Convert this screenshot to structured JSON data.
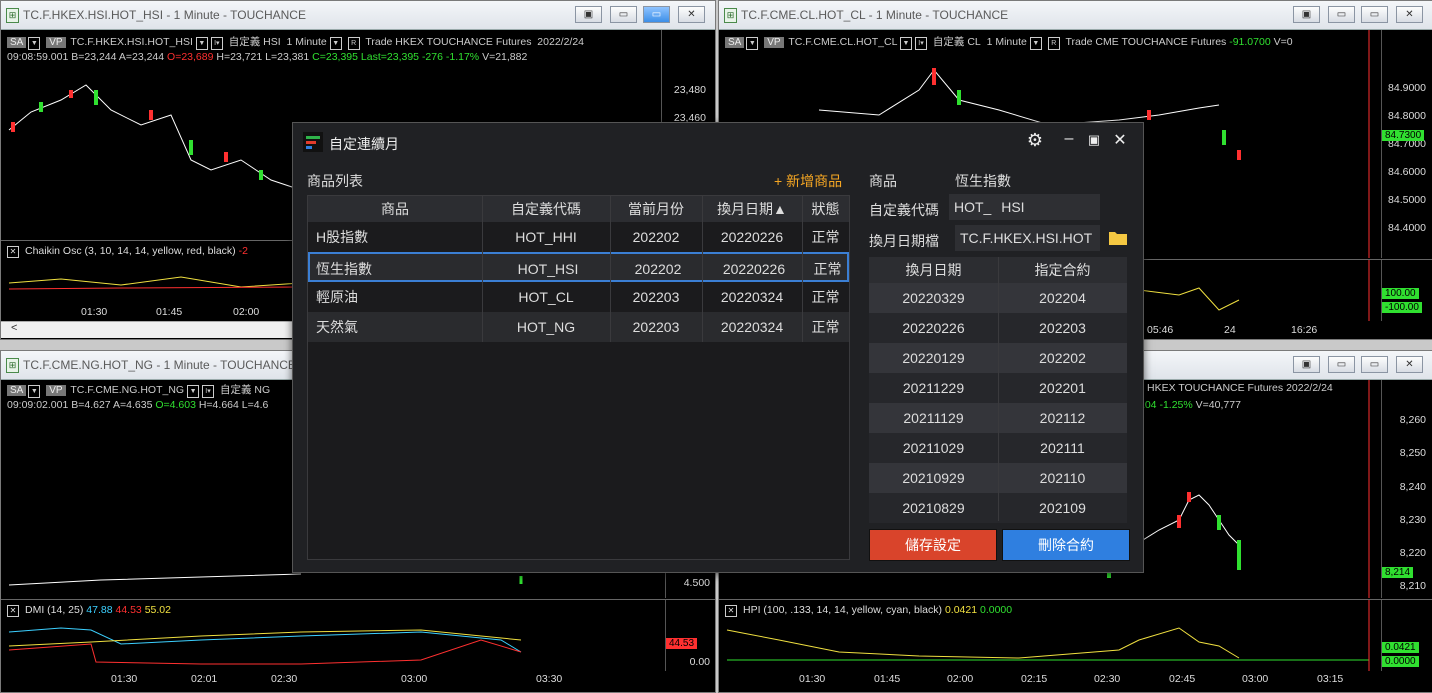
{
  "windows": {
    "hsi": {
      "title": "TC.F.HKEX.HSI.HOT_HSI - 1 Minute - TOUCHANCE",
      "sa": "SA",
      "vp": "VP",
      "symbol": "TC.F.HKEX.HSI.HOT_HSI",
      "custom": "自定義 HSI",
      "interval": "1 Minute",
      "r": "R",
      "trade": "Trade  HKEX  TOUCHANCE  Futures",
      "date": "2022/2/24",
      "time": "09:08:59.001",
      "bid": "B=23,244",
      "ask": "A=23,244",
      "open": "O=23,689",
      "high": "H=23,721",
      "low": "L=23,381",
      "close": "C=23,395",
      "last": "Last=23,395",
      "chg": "-276",
      "pct": "-1.17%",
      "vol": "V=21,882",
      "yticks": [
        "23,480",
        "23,460"
      ],
      "indicator": "Chaikin Osc   (3,  10,  14,  14,  yellow,  red,  black)",
      "indicator_value": "-2",
      "xticks": [
        "01:30",
        "01:45",
        "02:00"
      ],
      "scroll_left": "<"
    },
    "cl": {
      "title": "TC.F.CME.CL.HOT_CL - 1 Minute - TOUCHANCE",
      "sa": "SA",
      "vp": "VP",
      "symbol": "TC.F.CME.CL.HOT_CL",
      "custom": "自定義 CL",
      "interval": "1 Minute",
      "r": "R",
      "trade": "Trade  CME  TOUCHANCE  Futures",
      "chg": "-91.0700",
      "vol": "V=0",
      "yticks": [
        "84.9000",
        "84.8000",
        "84.7000",
        "84.6000",
        "84.5000",
        "84.4000"
      ],
      "last_tag": "84.7300",
      "sub_tags": [
        "100.00",
        "-100.00"
      ],
      "xticks": [
        "05:46",
        "24",
        "16:26"
      ]
    },
    "ng": {
      "title": "TC.F.CME.NG.HOT_NG - 1 Minute - TOUCHANCE",
      "sa": "SA",
      "vp": "VP",
      "symbol": "TC.F.CME.NG.HOT_NG",
      "custom": "自定義 NG",
      "time": "09:09:02.001",
      "bid": "B=4.627",
      "ask": "A=4.635",
      "open": "O=4.603",
      "high": "H=4.664",
      "low": "L=4.6",
      "ytick": "4.500",
      "indicator": "DMI     (14,  25)",
      "v1": "47.88",
      "v2": "44.53",
      "v3": "55.02",
      "tag1": "44.53",
      "tag2": "0.00",
      "xticks": [
        "01:30",
        "02:01",
        "02:30",
        "03:00",
        "03:30"
      ]
    },
    "hhi": {
      "header": "HKEX  TOUCHANCE  Futures   2022/2/24",
      "chg": "104",
      "pct": "-1.25%",
      "vol": "V=40,777",
      "yticks": [
        "8,260",
        "8,250",
        "8,240",
        "8,230",
        "8,220",
        "8,210"
      ],
      "last_tag": "8,214",
      "indicator": "HPI     (100,  .133,  14,  14,  yellow,  cyan,  black)",
      "v1": "0.0421",
      "v2": "0.0000",
      "tag1": "0.0421",
      "tag2": "0.0000",
      "xticks": [
        "01:30",
        "01:45",
        "02:00",
        "02:15",
        "02:30",
        "02:45",
        "03:00",
        "03:15"
      ]
    }
  },
  "dialog": {
    "title": "自定連續月",
    "list_label": "商品列表",
    "add_label": "+ 新增商品",
    "columns": [
      "商品",
      "自定義代碼",
      "當前月份",
      "換月日期▲",
      "狀態"
    ],
    "rows": [
      {
        "name": "H股指數",
        "code": "HOT_HHI",
        "month": "202202",
        "roll": "20220226",
        "status": "正常"
      },
      {
        "name": "恆生指數",
        "code": "HOT_HSI",
        "month": "202202",
        "roll": "20220226",
        "status": "正常"
      },
      {
        "name": "輕原油",
        "code": "HOT_CL",
        "month": "202203",
        "roll": "20220324",
        "status": "正常"
      },
      {
        "name": "天然氣",
        "code": "HOT_NG",
        "month": "202203",
        "roll": "20220324",
        "status": "正常"
      }
    ],
    "selected_row": 1,
    "product_label": "商品",
    "product_value": "恆生指數",
    "code_label": "自定義代碼",
    "code_prefix": "HOT_",
    "code_value": "HSI",
    "file_label": "換月日期檔",
    "file_value": "TC.F.HKEX.HSI.HOT",
    "roll_columns": [
      "換月日期",
      "指定合約"
    ],
    "roll_rows": [
      {
        "date": "20220329",
        "contract": "202204"
      },
      {
        "date": "20220226",
        "contract": "202203"
      },
      {
        "date": "20220129",
        "contract": "202202"
      },
      {
        "date": "20211229",
        "contract": "202201"
      },
      {
        "date": "20211129",
        "contract": "202112"
      },
      {
        "date": "20211029",
        "contract": "202111"
      },
      {
        "date": "20210929",
        "contract": "202110"
      },
      {
        "date": "20210829",
        "contract": "202109"
      }
    ],
    "save_label": "儲存設定",
    "delete_label": "刪除合約",
    "colors": {
      "save": "#d9442b",
      "delete": "#2f7fe0",
      "accent": "#f5a623",
      "select": "#3b7fd4"
    }
  }
}
